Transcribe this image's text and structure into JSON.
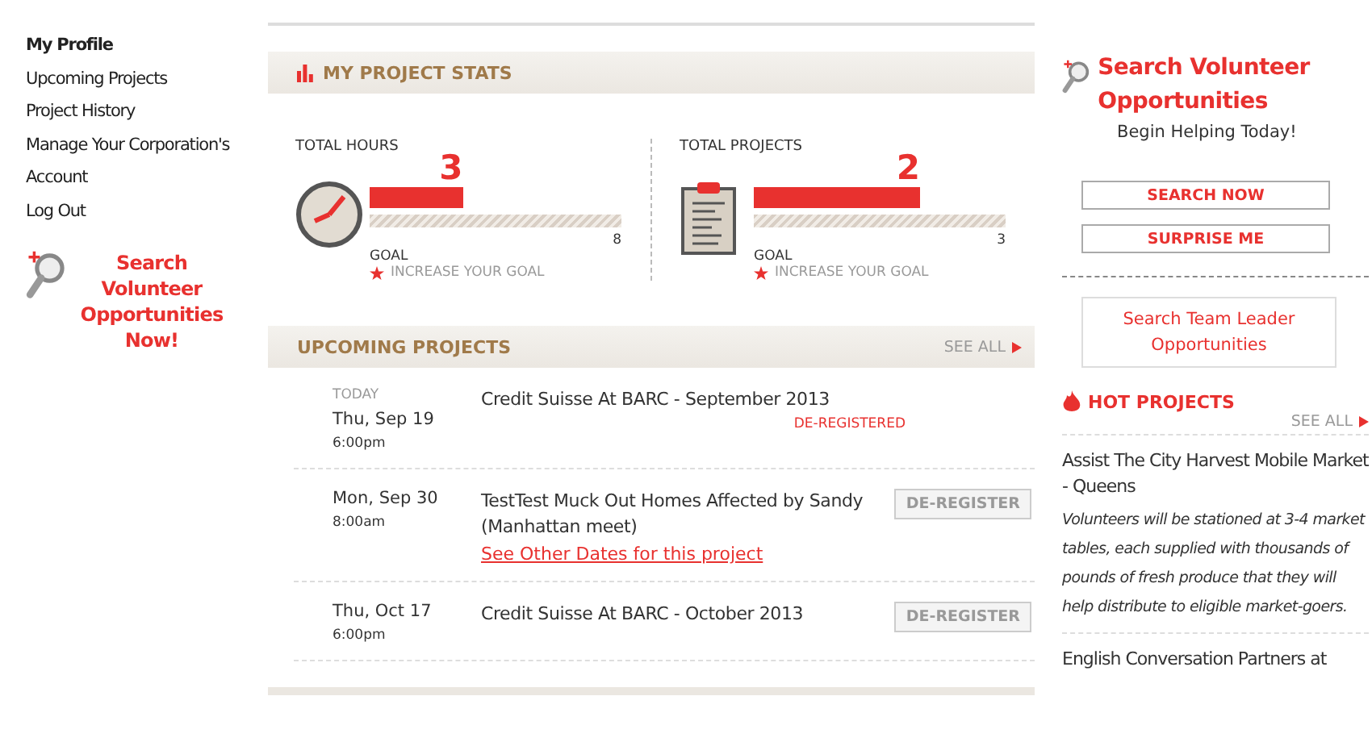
{
  "sidebar": {
    "items": [
      {
        "label": "My Profile",
        "selected": true
      },
      {
        "label": "Upcoming Projects",
        "selected": false
      },
      {
        "label": "Project History",
        "selected": false
      },
      {
        "label": "Manage Your Corporation's Account",
        "selected": false
      },
      {
        "label": "Log Out",
        "selected": false
      }
    ],
    "promo": "Search Volunteer Opportunities Now!"
  },
  "stats": {
    "title": "MY PROJECT STATS",
    "items": [
      {
        "kind": "hours",
        "label": "TOTAL HOURS",
        "value": "3",
        "level": 0.37,
        "goal": "8",
        "goal_label": "GOAL",
        "increase": "INCREASE YOUR GOAL"
      },
      {
        "kind": "projects",
        "label": "TOTAL PROJECTS",
        "value": "2",
        "level": 0.66,
        "goal": "3",
        "goal_label": "GOAL",
        "increase": "INCREASE YOUR GOAL"
      }
    ]
  },
  "upcoming": {
    "title": "UPCOMING PROJECTS",
    "see_all": "SEE ALL",
    "rows": [
      {
        "today": "TODAY",
        "date": "Thu, Sep 19",
        "time": "6:00pm",
        "title": "Credit Suisse At BARC - September 2013",
        "status": {
          "kind": "label",
          "text": "DE-REGISTERED"
        }
      },
      {
        "date": "Mon, Sep 30",
        "time": "8:00am",
        "title": "TestTest Muck Out Homes Affected by Sandy (Manhattan meet)",
        "link": "See Other Dates for this project",
        "status": {
          "kind": "button",
          "text": "DE-REGISTER"
        }
      },
      {
        "date": "Thu, Oct 17",
        "time": "6:00pm",
        "title": "Credit Suisse At BARC - October 2013",
        "status": {
          "kind": "button",
          "text": "DE-REGISTER"
        }
      }
    ]
  },
  "search": {
    "title": "Search Volunteer Opportunities",
    "subtitle": "Begin Helping Today!",
    "buttons": [
      "SEARCH NOW",
      "SURPRISE ME"
    ],
    "team_leader": "Search Team Leader Opportunities"
  },
  "hot": {
    "title": "HOT PROJECTS",
    "see_all": "SEE ALL",
    "items": [
      {
        "title": "Assist The City Harvest Mobile Market - Queens",
        "description": "Volunteers will be stationed at 3-4 market tables, each supplied with thousands of pounds of fresh produce that they will help distribute to eligible market-goers."
      },
      {
        "title": "English Conversation Partners at"
      }
    ]
  }
}
